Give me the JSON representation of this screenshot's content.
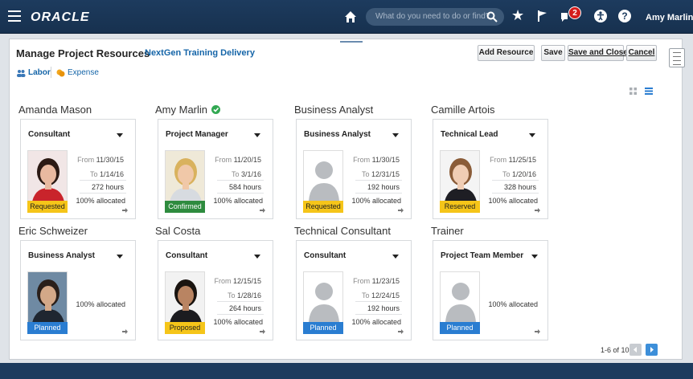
{
  "header": {
    "logo": "ORACLE",
    "search_placeholder": "What do you need to do or find?",
    "notification_count": "2",
    "help_glyph": "?",
    "user_menu": "Amy Marlin ▾"
  },
  "page": {
    "title": "Manage Project Resources",
    "project": "NextGen Training Delivery"
  },
  "actions": {
    "add_resource": "Add Resource",
    "save": "Save",
    "save_close": "Save and Close",
    "cancel": "Cancel"
  },
  "chips": [
    {
      "label": "Labor",
      "icon": "people-icon"
    },
    {
      "label": "Expense",
      "icon": "coins-icon"
    }
  ],
  "resources": [
    {
      "name": "Amanda Mason",
      "role": "Consultant",
      "from": "11/30/15",
      "to": "1/14/16",
      "hours": "272 hours",
      "allocated": "100% allocated",
      "status": "Requested",
      "photo": "woman-red"
    },
    {
      "name": "Amy Marlin",
      "verified": true,
      "role": "Project Manager",
      "from": "11/20/15",
      "to": "3/1/16",
      "hours": "584 hours",
      "allocated": "100% allocated",
      "status": "Confirmed",
      "photo": "woman-blonde"
    },
    {
      "name": "Business Analyst",
      "role": "Business Analyst",
      "from": "11/30/15",
      "to": "12/31/15",
      "hours": "192 hours",
      "allocated": "100% allocated",
      "status": "Requested",
      "photo": "placeholder"
    },
    {
      "name": "Camille Artois",
      "role": "Technical Lead",
      "from": "11/25/15",
      "to": "1/20/16",
      "hours": "328 hours",
      "allocated": "100% allocated",
      "status": "Reserved",
      "photo": "woman-suit"
    },
    {
      "name": "Eric Schweizer",
      "role": "Business Analyst",
      "from": "",
      "to": "",
      "hours": "",
      "allocated": "100% allocated",
      "status": "Planned",
      "photo": "man-dark"
    },
    {
      "name": "Sal Costa",
      "role": "Consultant",
      "from": "12/15/15",
      "to": "1/28/16",
      "hours": "264 hours",
      "allocated": "100% allocated",
      "status": "Proposed",
      "photo": "man-phone"
    },
    {
      "name": "Technical Consultant",
      "role": "Consultant",
      "from": "11/23/15",
      "to": "12/24/15",
      "hours": "192 hours",
      "allocated": "100% allocated",
      "status": "Planned",
      "photo": "placeholder"
    },
    {
      "name": "Trainer",
      "role": "Project Team Member",
      "from": "",
      "to": "",
      "hours": "",
      "allocated": "100% allocated",
      "status": "Planned",
      "photo": "placeholder"
    }
  ],
  "labels": {
    "from": "From ",
    "to": "To "
  },
  "pager": {
    "text": "1-6 of 10"
  },
  "colors": {
    "header_bg": "#1d3b5e",
    "link": "#1565a8",
    "requested": "#f5c519",
    "confirmed": "#2e8b3e",
    "planned": "#2a7dd1"
  }
}
